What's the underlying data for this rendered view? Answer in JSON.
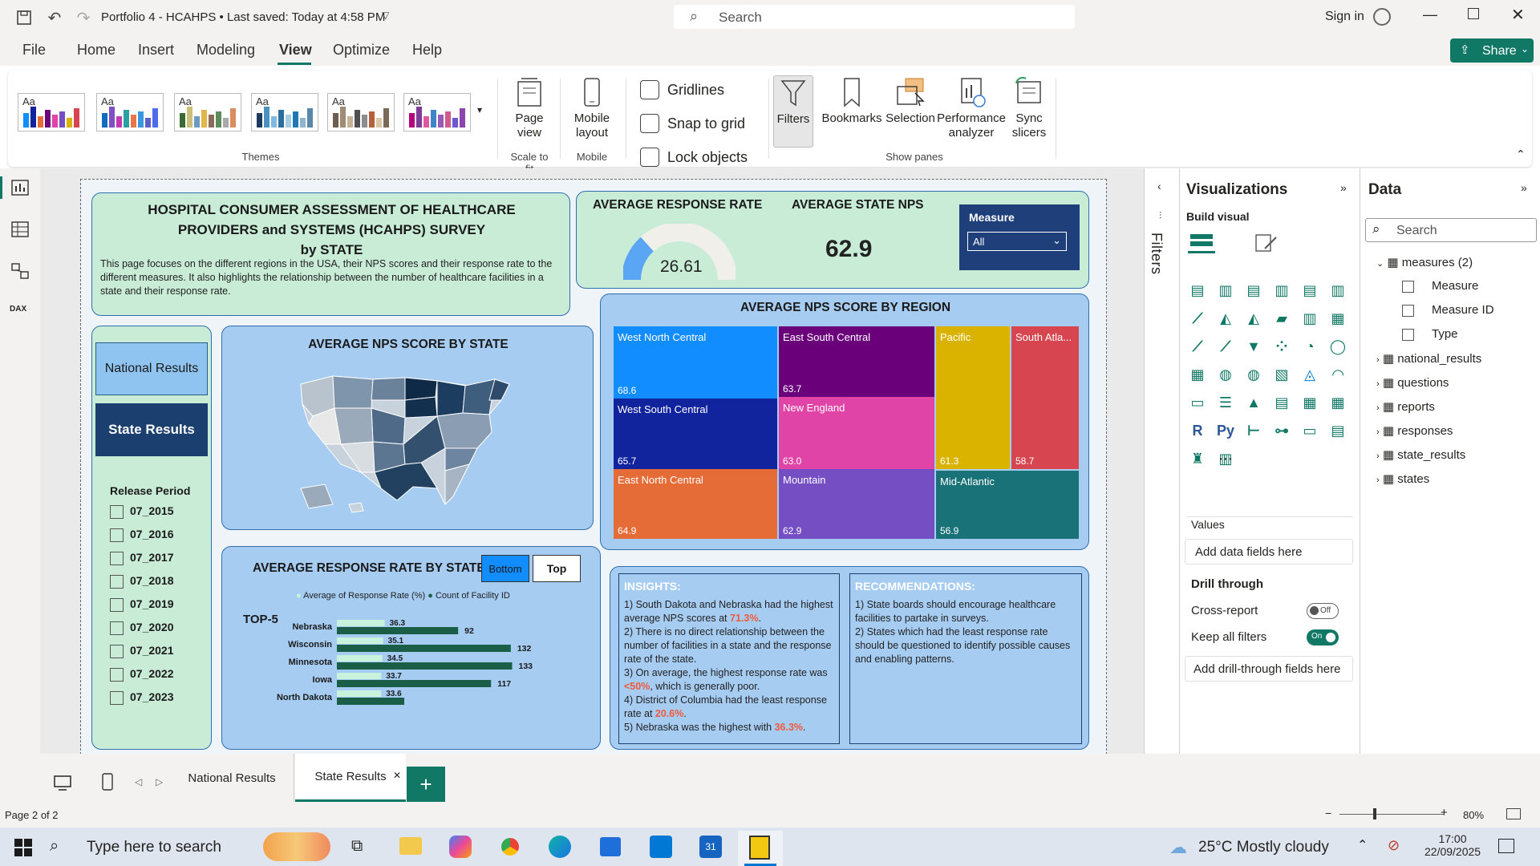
{
  "titlebar": {
    "title": "Portfolio 4 - HCAHPS • Last saved: Today at 4:58 PM",
    "search_placeholder": "Search",
    "sign_in": "Sign in"
  },
  "menu": {
    "items": [
      "File",
      "Home",
      "Insert",
      "Modeling",
      "View",
      "Optimize",
      "Help"
    ],
    "active": "View",
    "share": "Share"
  },
  "ribbon": {
    "themes_label": "Themes",
    "theme_sample": "Aa",
    "page_view": "Page view",
    "scale_to_fit": "Scale to fit",
    "mobile_layout": "Mobile layout",
    "mobile": "Mobile",
    "gridlines": "Gridlines",
    "snap_to_grid": "Snap to grid",
    "lock_objects": "Lock objects",
    "filters": "Filters",
    "bookmarks": "Bookmarks",
    "selection": "Selection",
    "performance_analyzer": "Performance analyzer",
    "sync_slicers": "Sync slicers",
    "show_panes": "Show panes"
  },
  "report": {
    "title_line1": "HOSPITAL CONSUMER ASSESSMENT OF HEALTHCARE",
    "title_line2": "PROVIDERS and SYSTEMS (HCAHPS) SURVEY",
    "title_line3": "by STATE",
    "description": "This page focuses on the different regions in the USA, their NPS scores and their response rate to the different measures. It also highlights the relationship between the number of healthcare facilities in a state and their response rate.",
    "avg_response_rate_label": "AVERAGE RESPONSE RATE",
    "avg_response_rate_value": "26.61",
    "avg_response_rate_fraction": 0.2661,
    "avg_state_nps_label": "AVERAGE STATE NPS",
    "avg_state_nps_value": "62.9",
    "measure_label": "Measure",
    "measure_value": "All",
    "nav_national": "National Results",
    "nav_state": "State Results",
    "release_period_label": "Release Period",
    "release_periods": [
      "07_2015",
      "07_2016",
      "07_2017",
      "07_2018",
      "07_2019",
      "07_2020",
      "07_2021",
      "07_2022",
      "07_2023"
    ],
    "map_title": "AVERAGE NPS SCORE BY STATE",
    "treemap_title": "AVERAGE NPS SCORE BY REGION",
    "treemap": [
      {
        "name": "West North Central",
        "value": "68.6",
        "color": "#118dff"
      },
      {
        "name": "West South Central",
        "value": "65.7",
        "color": "#12239e"
      },
      {
        "name": "East North Central",
        "value": "64.9",
        "color": "#e66c37"
      },
      {
        "name": "East South Central",
        "value": "63.7",
        "color": "#6b007b"
      },
      {
        "name": "New England",
        "value": "63.0",
        "color": "#e044a7"
      },
      {
        "name": "Mountain",
        "value": "62.9",
        "color": "#744ec2"
      },
      {
        "name": "Pacific",
        "value": "61.3",
        "color": "#d9b300"
      },
      {
        "name": "South Atla...",
        "value": "58.7",
        "color": "#d64550"
      },
      {
        "name": "Mid-Atlantic",
        "value": "56.9",
        "color": "#197278"
      }
    ],
    "bar_title": "AVERAGE RESPONSE RATE BY STATE",
    "bar_btn_bottom": "Bottom",
    "bar_btn_top": "Top",
    "legend_response": "Average of Response Rate (%)",
    "legend_count": "Count of Facility ID",
    "top5_label": "TOP-5",
    "insights_title": "INSIGHTS:",
    "insights": [
      {
        "pre": "1) South Dakota and Nebraska had the highest average NPS scores at ",
        "hl": "71.3%",
        "post": "."
      },
      {
        "pre": "2)  There is no direct relationship between the number of facilities in a state and the response rate of the state.",
        "hl": "",
        "post": ""
      },
      {
        "pre": "3)  On average, the highest response rate was ",
        "hl": "<50%",
        "post": ", which is generally poor."
      },
      {
        "pre": "4) District of Columbia had the least response rate at ",
        "hl": "20.6%",
        "post": "."
      },
      {
        "pre": "5) Nebraska was the highest with ",
        "hl": "36.3%",
        "post": "."
      }
    ],
    "rec_title": "RECOMMENDATIONS:",
    "recommendations": [
      "1) State boards should encourage healthcare facilities to partake in surveys.",
      "2) States which had the least response rate should be questioned to identify possible causes and enabling patterns."
    ]
  },
  "chart_data": {
    "type": "bar",
    "title": "AVERAGE RESPONSE RATE BY STATE",
    "categories": [
      "Nebraska",
      "Wisconsin",
      "Minnesota",
      "Iowa",
      "North Dakota"
    ],
    "series": [
      {
        "name": "Average of Response Rate (%)",
        "values": [
          36.3,
          35.1,
          34.5,
          33.7,
          33.6
        ],
        "color": "#c9f2dc"
      },
      {
        "name": "Count of Facility ID",
        "values": [
          92,
          132,
          133,
          117,
          null
        ],
        "color": "#1b5e48"
      }
    ],
    "value_labels_rate": [
      "36.3",
      "35.1",
      "34.5",
      "33.7",
      "33.6"
    ],
    "value_labels_count": [
      "92",
      "132",
      "133",
      "117",
      ""
    ]
  },
  "filters_strip": {
    "label": "Filters"
  },
  "viz": {
    "title": "Visualizations",
    "build_visual": "Build visual",
    "values": "Values",
    "add_fields": "Add data fields here",
    "drill_through": "Drill through",
    "cross_report": "Cross-report",
    "cross_report_state": "Off",
    "keep_all_filters": "Keep all filters",
    "keep_all_filters_state": "On",
    "add_drill": "Add drill-through fields here"
  },
  "data_pane": {
    "title": "Data",
    "search_placeholder": "Search",
    "measures_group": "measures (2)",
    "measure_fields": [
      "Measure",
      "Measure ID",
      "Type"
    ],
    "tables": [
      "national_results",
      "questions",
      "reports",
      "responses",
      "state_results",
      "states"
    ]
  },
  "pages": {
    "tabs": [
      "National Results",
      "State Results"
    ],
    "active": "State Results",
    "status": "Page 2 of 2",
    "zoom": "80%"
  },
  "taskbar": {
    "search": "Type here to search",
    "weather": "25°C  Mostly cloudy",
    "time": "17:00",
    "date": "22/09/2025"
  }
}
